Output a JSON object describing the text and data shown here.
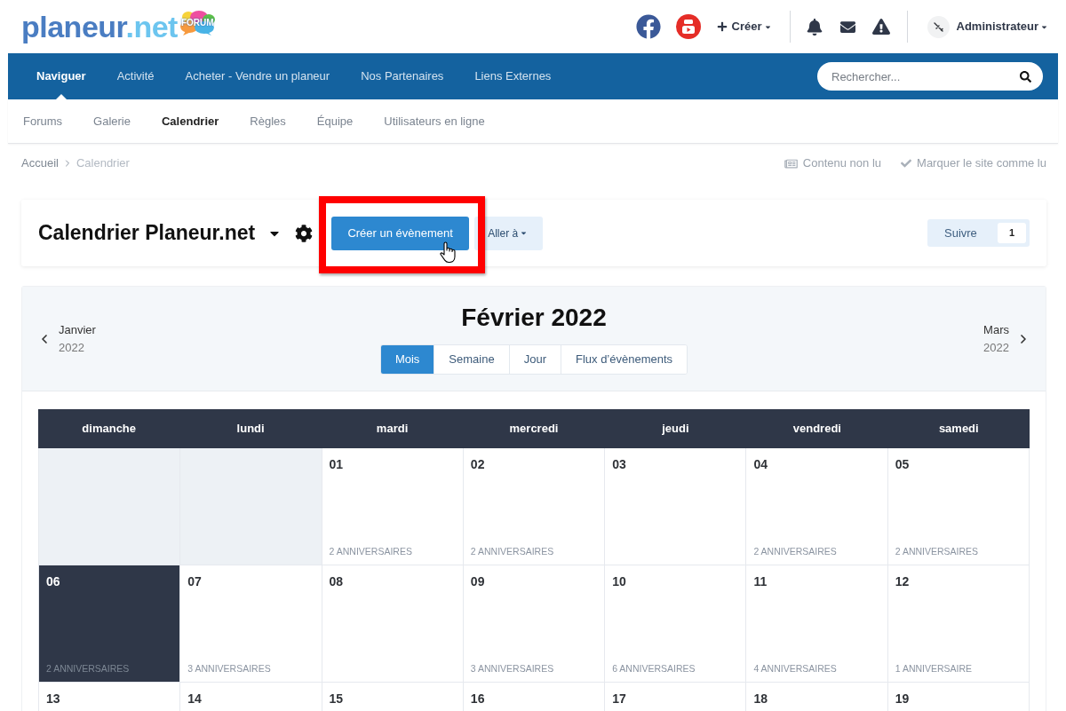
{
  "logo": {
    "name": "planeur",
    "suffix": ".net",
    "badge": "FORUM"
  },
  "user_bar": {
    "create_label": "Créer",
    "user_name": "Administrateur"
  },
  "main_nav": {
    "items": [
      {
        "label": "Naviguer",
        "selected": true
      },
      {
        "label": "Activité",
        "selected": false
      },
      {
        "label": "Acheter - Vendre un planeur",
        "selected": false
      },
      {
        "label": "Nos Partenaires",
        "selected": false
      },
      {
        "label": "Liens Externes",
        "selected": false
      }
    ],
    "search": {
      "placeholder": "Rechercher..."
    }
  },
  "sub_nav": {
    "items": [
      {
        "label": "Forums",
        "selected": false
      },
      {
        "label": "Galerie",
        "selected": false
      },
      {
        "label": "Calendrier",
        "selected": true
      },
      {
        "label": "Règles",
        "selected": false
      },
      {
        "label": "Équipe",
        "selected": false
      },
      {
        "label": "Utilisateurs en ligne",
        "selected": false
      }
    ]
  },
  "breadcrumb": [
    "Accueil",
    "Calendrier"
  ],
  "page_actions": {
    "unread_content": "Contenu non lu",
    "mark_read": "Marquer le site comme lu"
  },
  "calendar_header": {
    "title": "Calendrier Planeur.net",
    "create_button": "Créer un évènement",
    "goto_button": "Aller à",
    "follow": {
      "label": "Suivre",
      "count": "1"
    }
  },
  "month_nav": {
    "previous": {
      "month": "Janvier",
      "year": "2022"
    },
    "title": "Février 2022",
    "next": {
      "month": "Mars",
      "year": "2022"
    },
    "views": [
      {
        "label": "Mois",
        "selected": true
      },
      {
        "label": "Semaine",
        "selected": false
      },
      {
        "label": "Jour",
        "selected": false
      },
      {
        "label": "Flux d’évènements",
        "selected": false
      }
    ]
  },
  "calendar": {
    "weekdays": [
      "dimanche",
      "lundi",
      "mardi",
      "mercredi",
      "jeudi",
      "vendredi",
      "samedi"
    ],
    "weeks": [
      [
        {
          "kind": "blank"
        },
        {
          "kind": "blank"
        },
        {
          "kind": "day",
          "day": "01",
          "note": "2 ANNIVERSAIRES",
          "today": false
        },
        {
          "kind": "day",
          "day": "02",
          "note": "2 ANNIVERSAIRES",
          "today": false
        },
        {
          "kind": "day",
          "day": "03",
          "today": false
        },
        {
          "kind": "day",
          "day": "04",
          "note": "2 ANNIVERSAIRES",
          "today": false
        },
        {
          "kind": "day",
          "day": "05",
          "note": "2 ANNIVERSAIRES",
          "today": false
        }
      ],
      [
        {
          "kind": "day",
          "day": "06",
          "note": "2 ANNIVERSAIRES",
          "today": true
        },
        {
          "kind": "day",
          "day": "07",
          "note": "3 ANNIVERSAIRES",
          "today": false
        },
        {
          "kind": "day",
          "day": "08",
          "today": false
        },
        {
          "kind": "day",
          "day": "09",
          "note": "3 ANNIVERSAIRES",
          "today": false
        },
        {
          "kind": "day",
          "day": "10",
          "note": "6 ANNIVERSAIRES",
          "today": false
        },
        {
          "kind": "day",
          "day": "11",
          "note": "4 ANNIVERSAIRES",
          "today": false
        },
        {
          "kind": "day",
          "day": "12",
          "note": "1 ANNIVERSAIRE",
          "today": false
        }
      ],
      [
        {
          "kind": "day",
          "day": "13",
          "today": false
        },
        {
          "kind": "day",
          "day": "14",
          "today": false
        },
        {
          "kind": "day",
          "day": "15",
          "today": false
        },
        {
          "kind": "day",
          "day": "16",
          "today": false
        },
        {
          "kind": "day",
          "day": "17",
          "today": false
        },
        {
          "kind": "day",
          "day": "18",
          "today": false
        },
        {
          "kind": "day",
          "day": "19",
          "today": false
        }
      ]
    ]
  }
}
